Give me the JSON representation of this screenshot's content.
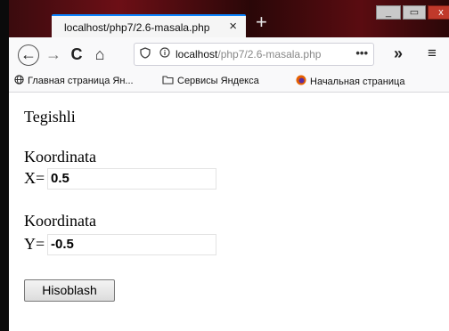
{
  "browser": {
    "tab_title": "localhost/php7/2.6-masala.php",
    "tab_close": "×",
    "new_tab": "+",
    "window_controls": {
      "minimize": "_",
      "maximize": "▭",
      "close": "x"
    },
    "url_host": "localhost",
    "url_path": "/php7/2.6-masala.php",
    "url_more": "•••",
    "overflow": "»",
    "menu": "≡",
    "nav": {
      "back": "←",
      "forward": "→",
      "reload": "C",
      "home": "⌂"
    }
  },
  "bookmarks": [
    {
      "icon": "globe-icon",
      "label": "Главная страница Ян..."
    },
    {
      "icon": "folder-icon",
      "label": "Сервисы Яндекса"
    },
    {
      "icon": "firefox-icon",
      "label": "Начальная страница"
    }
  ],
  "page": {
    "heading": "Tegishli",
    "x_label": "Koordinata",
    "x_prefix": "X=",
    "x_value": "0.5",
    "y_label": "Koordinata",
    "y_prefix": "Y=",
    "y_value": "-0.5",
    "submit_label": "Hisoblash"
  },
  "colors": {
    "tab_accent": "#0a84ff",
    "titlebar": "#6d0f16"
  }
}
